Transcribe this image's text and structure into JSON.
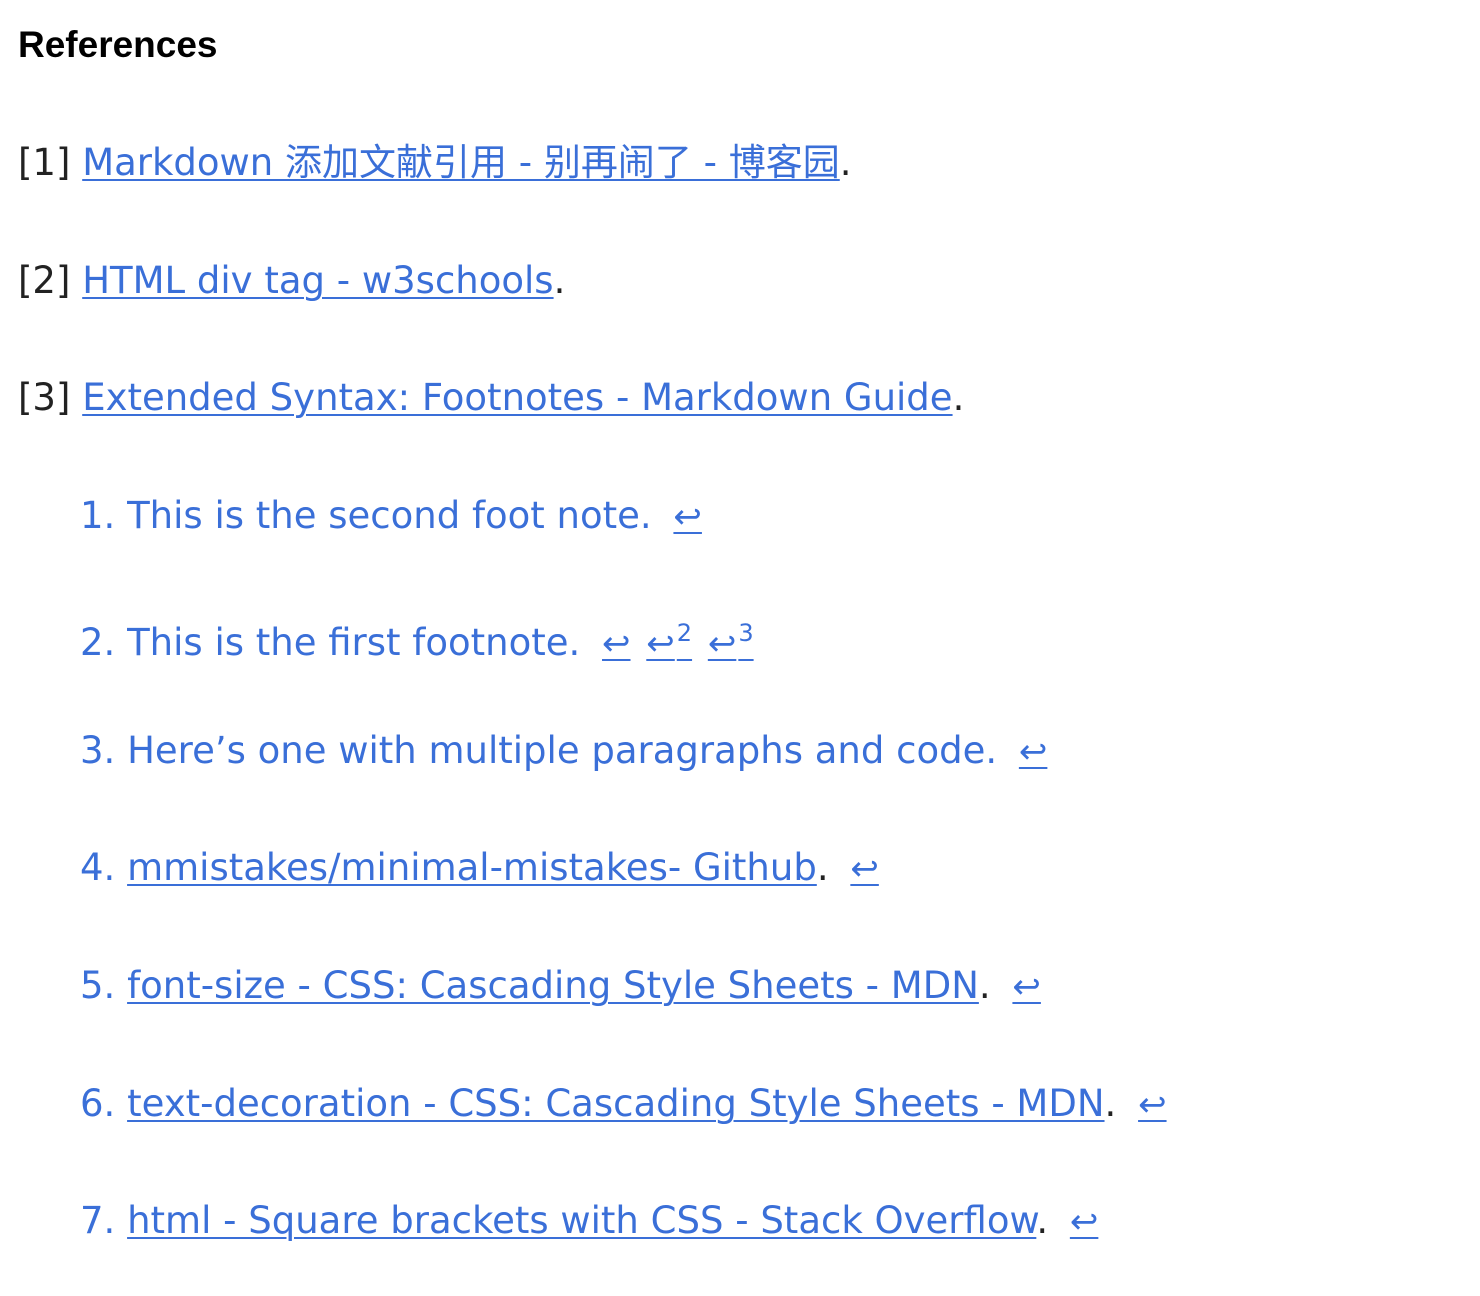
{
  "heading": "References",
  "references": [
    {
      "num": "[1]",
      "link": "Markdown 添加文献引用 - 别再闹了 - 博客园",
      "end": "."
    },
    {
      "num": "[2]",
      "link": "HTML div tag - w3schools",
      "end": "."
    },
    {
      "num": "[3]",
      "link": "Extended Syntax: Footnotes - Markdown Guide",
      "end": "."
    }
  ],
  "footnotes": [
    {
      "num": "1.",
      "text": "This is the second foot note.",
      "back": "↩"
    },
    {
      "num": "2.",
      "text": "This is the first footnote.",
      "back": "↩",
      "back2": "↩",
      "back2_sup": "2",
      "back3": "↩",
      "back3_sup": "3"
    },
    {
      "num": "3.",
      "text": "Here’s one with multiple paragraphs and code.",
      "back": "↩"
    },
    {
      "num": "4.",
      "link": "mmistakes/minimal-mistakes- Github",
      "end": ".",
      "back": "↩"
    },
    {
      "num": "5.",
      "link": "font-size - CSS: Cascading Style Sheets - MDN",
      "end": ".",
      "back": "↩"
    },
    {
      "num": "6.",
      "link": "text-decoration - CSS: Cascading Style Sheets - MDN",
      "end": ".",
      "back": "↩"
    },
    {
      "num": "7.",
      "link": "html - Square brackets with CSS - Stack Overflow",
      "end": ".",
      "back": "↩"
    }
  ],
  "colors": {
    "link": "#3a6fd8",
    "backref": "#e00000",
    "text": "#222222",
    "heading": "#000000"
  }
}
